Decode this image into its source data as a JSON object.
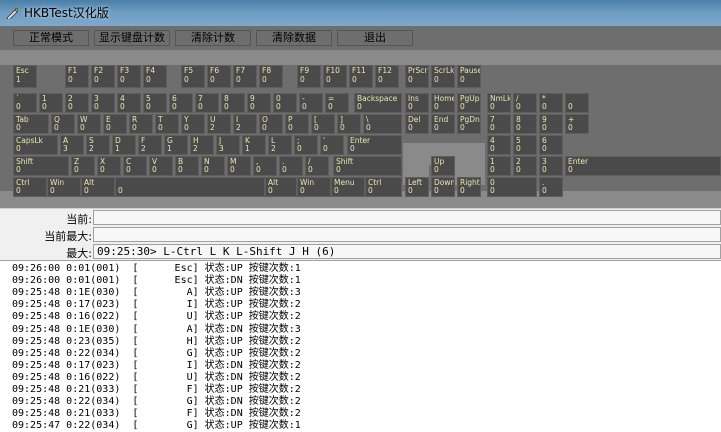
{
  "window": {
    "title": "HKBTest汉化版"
  },
  "toolbar": [
    {
      "label": "正常模式",
      "style": "green"
    },
    {
      "label": "显示键盘计数",
      "style": "green"
    },
    {
      "label": "清除计数",
      "style": "grey"
    },
    {
      "label": "清除数据",
      "style": "grey"
    },
    {
      "label": "退出",
      "style": "grey"
    }
  ],
  "keys": [
    {
      "label": "Esc",
      "count": "1"
    },
    {
      "label": "F1",
      "count": "0"
    },
    {
      "label": "F2",
      "count": "0"
    },
    {
      "label": "F3",
      "count": "0"
    },
    {
      "label": "F4",
      "count": "0"
    },
    {
      "label": "F5",
      "count": "0"
    },
    {
      "label": "F6",
      "count": "0"
    },
    {
      "label": "F7",
      "count": "0"
    },
    {
      "label": "F8",
      "count": "0"
    },
    {
      "label": "F9",
      "count": "0"
    },
    {
      "label": "F10",
      "count": "0"
    },
    {
      "label": "F11",
      "count": "0"
    },
    {
      "label": "F12",
      "count": "0"
    },
    {
      "label": "PrScr",
      "count": "0"
    },
    {
      "label": "ScrLk",
      "count": "0"
    },
    {
      "label": "Pause",
      "count": "0"
    },
    {
      "label": "`",
      "count": "0"
    },
    {
      "label": "1",
      "count": "0"
    },
    {
      "label": "2",
      "count": "0"
    },
    {
      "label": "3",
      "count": "0"
    },
    {
      "label": "4",
      "count": "0"
    },
    {
      "label": "5",
      "count": "0"
    },
    {
      "label": "6",
      "count": "0"
    },
    {
      "label": "7",
      "count": "0"
    },
    {
      "label": "8",
      "count": "0"
    },
    {
      "label": "9",
      "count": "0"
    },
    {
      "label": "0",
      "count": "0"
    },
    {
      "label": "-",
      "count": "0"
    },
    {
      "label": "=",
      "count": "0"
    },
    {
      "label": "Backspace",
      "count": "0"
    },
    {
      "label": "Ins",
      "count": "0"
    },
    {
      "label": "Home",
      "count": "0"
    },
    {
      "label": "PgUp",
      "count": "0"
    },
    {
      "label": "NmLk",
      "count": "0"
    },
    {
      "label": "/",
      "count": "0"
    },
    {
      "label": "*",
      "count": "0"
    },
    {
      "label": "",
      "count": "0"
    },
    {
      "label": "Tab",
      "count": "0"
    },
    {
      "label": "Q",
      "count": "0"
    },
    {
      "label": "W",
      "count": "0"
    },
    {
      "label": "E",
      "count": "0"
    },
    {
      "label": "R",
      "count": "0"
    },
    {
      "label": "T",
      "count": "0"
    },
    {
      "label": "Y",
      "count": "0"
    },
    {
      "label": "U",
      "count": "2"
    },
    {
      "label": "I",
      "count": "2"
    },
    {
      "label": "O",
      "count": "0"
    },
    {
      "label": "P",
      "count": "0"
    },
    {
      "label": "[",
      "count": "0"
    },
    {
      "label": "]",
      "count": "0"
    },
    {
      "label": "\\",
      "count": "0"
    },
    {
      "label": "Del",
      "count": "0"
    },
    {
      "label": "End",
      "count": "0"
    },
    {
      "label": "PgDn",
      "count": "0"
    },
    {
      "label": "7",
      "count": "0"
    },
    {
      "label": "8",
      "count": "0"
    },
    {
      "label": "9",
      "count": "0"
    },
    {
      "label": "+",
      "count": "0"
    },
    {
      "label": "CapsLk",
      "count": "0"
    },
    {
      "label": "A",
      "count": "3"
    },
    {
      "label": "S",
      "count": "2"
    },
    {
      "label": "D",
      "count": "1"
    },
    {
      "label": "F",
      "count": "2"
    },
    {
      "label": "G",
      "count": "1"
    },
    {
      "label": "H",
      "count": "2"
    },
    {
      "label": "J",
      "count": "3"
    },
    {
      "label": "K",
      "count": "1"
    },
    {
      "label": "L",
      "count": "2"
    },
    {
      "label": ";",
      "count": "0"
    },
    {
      "label": "'",
      "count": "0"
    },
    {
      "label": "Enter",
      "count": "0"
    },
    {
      "label": "4",
      "count": "0"
    },
    {
      "label": "5",
      "count": "0"
    },
    {
      "label": "6",
      "count": "0"
    },
    {
      "label": "Shift",
      "count": "0"
    },
    {
      "label": "Z",
      "count": "0"
    },
    {
      "label": "X",
      "count": "0"
    },
    {
      "label": "C",
      "count": "0"
    },
    {
      "label": "V",
      "count": "0"
    },
    {
      "label": "B",
      "count": "0"
    },
    {
      "label": "N",
      "count": "0"
    },
    {
      "label": "M",
      "count": "0"
    },
    {
      "label": ",",
      "count": "0"
    },
    {
      "label": ".",
      "count": "0"
    },
    {
      "label": "/",
      "count": "0"
    },
    {
      "label": "Shift",
      "count": "0"
    },
    {
      "label": "Up",
      "count": "0"
    },
    {
      "label": "1",
      "count": "0"
    },
    {
      "label": "2",
      "count": "0"
    },
    {
      "label": "3",
      "count": "0"
    },
    {
      "label": "Enter",
      "count": "0"
    },
    {
      "label": "Ctrl",
      "count": "0"
    },
    {
      "label": "Win",
      "count": "0"
    },
    {
      "label": "Alt",
      "count": "0"
    },
    {
      "label": "",
      "count": "0"
    },
    {
      "label": "Alt",
      "count": "0"
    },
    {
      "label": "Win",
      "count": "0"
    },
    {
      "label": "Menu",
      "count": "0"
    },
    {
      "label": "Ctrl",
      "count": "0"
    },
    {
      "label": "Left",
      "count": "0"
    },
    {
      "label": "Down",
      "count": "0"
    },
    {
      "label": "Right",
      "count": "0"
    },
    {
      "label": "0",
      "count": "0"
    },
    {
      "label": ".",
      "count": "0"
    }
  ],
  "stats": {
    "current_label": "当前:",
    "current_value": "",
    "current_max_label": "当前最大:",
    "current_max_value": "",
    "max_label": "最大:",
    "max_value": "09:25:30> L-Ctrl L K L-Shift J H (6)"
  },
  "log": [
    "09:26:00 0:01(001)  [      Esc] 状态:UP 按键次数:1",
    "09:26:00 0:01(001)  [      Esc] 状态:DN 按键次数:1",
    "09:25:48 0:1E(030)  [        A] 状态:UP 按键次数:3",
    "09:25:48 0:17(023)  [        I] 状态:UP 按键次数:2",
    "09:25:48 0:16(022)  [        U] 状态:UP 按键次数:2",
    "09:25:48 0:1E(030)  [        A] 状态:DN 按键次数:3",
    "09:25:48 0:23(035)  [        H] 状态:UP 按键次数:2",
    "09:25:48 0:22(034)  [        G] 状态:UP 按键次数:2",
    "09:25:48 0:17(023)  [        I] 状态:DN 按键次数:2",
    "09:25:48 0:16(022)  [        U] 状态:DN 按键次数:2",
    "09:25:48 0:21(033)  [        F] 状态:UP 按键次数:2",
    "09:25:48 0:22(034)  [        G] 状态:DN 按键次数:2",
    "09:25:48 0:21(033)  [        F] 状态:DN 按键次数:2",
    "09:25:47 0:22(034)  [        G] 状态:UP 按键次数:1"
  ]
}
